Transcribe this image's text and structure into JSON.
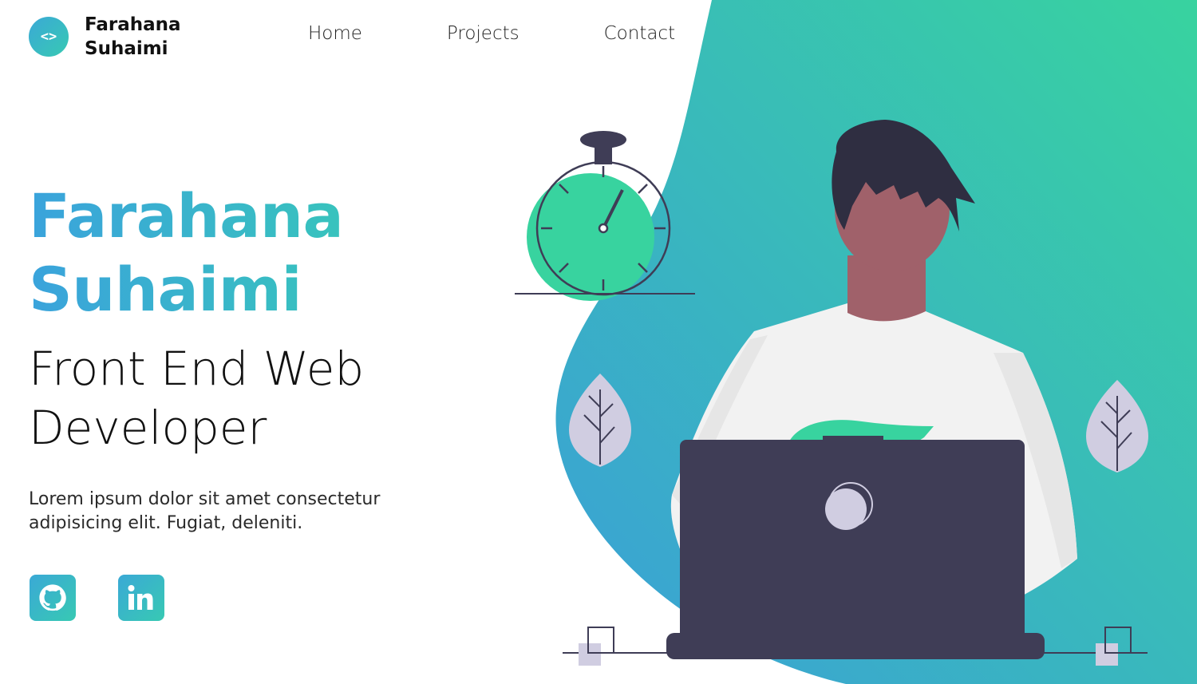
{
  "brand": {
    "logo_glyph": "<>",
    "name_line1": "Farahana",
    "name_line2": "Suhaimi"
  },
  "nav": {
    "items": [
      {
        "label": "Home"
      },
      {
        "label": "Projects"
      },
      {
        "label": "Contact"
      }
    ]
  },
  "hero": {
    "name_line1": "Farahana",
    "name_line2": "Suhaimi",
    "role_line1": "Front End Web",
    "role_line2": "Developer",
    "description_line1": "Lorem ipsum dolor sit amet consectetur",
    "description_line2": "adipisicing elit. Fugiat, deleniti."
  },
  "socials": [
    {
      "icon": "github-icon"
    },
    {
      "icon": "linkedin-icon"
    }
  ],
  "colors": {
    "gradient_start": "#38d39f",
    "gradient_end": "#3a9fd8",
    "accent_green": "#38d39f",
    "dark": "#3f3d56",
    "skin": "#a0616a",
    "leaf": "#d0cde1"
  }
}
